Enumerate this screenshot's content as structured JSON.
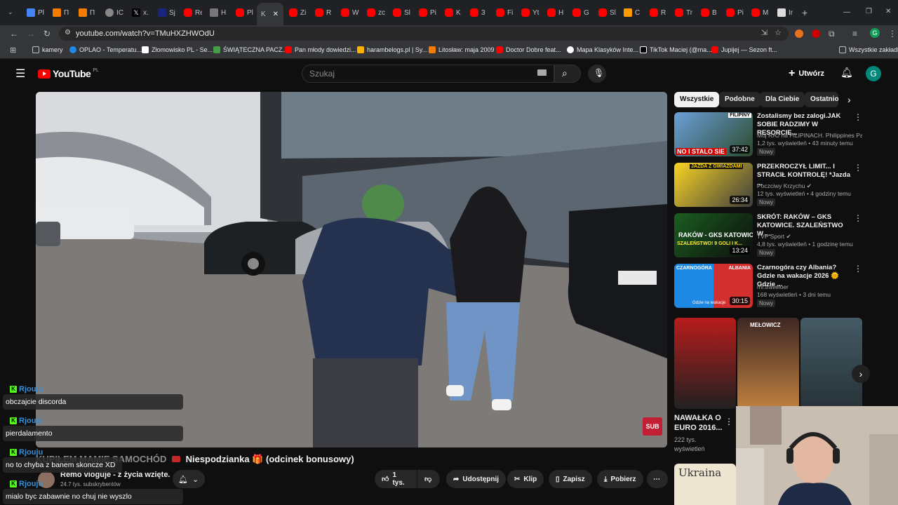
{
  "browser": {
    "tabs": [
      "Pl",
      "П",
      "П",
      "IC",
      "x.",
      "Sj",
      "Re",
      "H",
      "Pl",
      "K",
      "Zi",
      "R",
      "W",
      "zc",
      "Sl",
      "Pi",
      "K",
      "3",
      "Fi",
      "Yt",
      "H",
      "G",
      "Sl",
      "C",
      "R",
      "Tr",
      "B",
      "Pi",
      "M",
      "Ir"
    ],
    "url": "youtube.com/watch?v=TMuHXZHWOdU",
    "bookmarks": [
      "kamery",
      "OPLAO - Temperatu...",
      "Złomowisko PL - Se...",
      "ŚWIĄTECZNA PACZ...",
      "Pan młody dowiedzi...",
      "harambelogs.pl | Sy...",
      "Litosław: maja 2009",
      "Doctor Dobre feat...",
      "Mapa Klasyków Inte...",
      "TikTok Maciej (@ma...",
      "Jupijej — Sezon ft..."
    ],
    "all_bookmarks": "Wszystkie zakładki",
    "profile_initial": "G"
  },
  "youtube": {
    "logo": "YouTube",
    "region": "PL",
    "search_placeholder": "Szukaj",
    "create_label": "Utwórz",
    "avatar_initial": "G"
  },
  "video": {
    "title_prefix": "KUPIŁEM MAMIE SAMOCHÓD",
    "title_suffix": "Niespodzianka 🎁 (odcinek bonusowy)",
    "channel": "Remo vloguje - z życia wzięte.",
    "subscribers": "24.7 tys. subskrybentów",
    "sub_watermark": "SUB",
    "actions": {
      "likes": "1 tys.",
      "share": "Udostępnij",
      "clip": "Klip",
      "save": "Zapisz",
      "download": "Pobierz"
    }
  },
  "chips": [
    "Wszystkie",
    "Podobne",
    "Dla Ciebie",
    "Ostatnio"
  ],
  "recommendations": [
    {
      "title": "Zostalismy bez zalogi.JAK SOBIE RADZIMY W RESORCIE...",
      "channel": "Moj RAJ na FILIPINACH. Philippines Par...",
      "meta": "1,2 tys. wyświetleń • 43 minuty temu",
      "badge": "Nowy",
      "duration": "37:42",
      "thumb_text": "NO I STALO SIE",
      "thumb_top": "FILIPINY"
    },
    {
      "title": "PRZEKROCZYŁ LIMIT... I STRACIŁ KONTROLĘ! *Jazda ...",
      "channel": "Poczciwy Krzychu",
      "meta": "12 tys. wyświetleń • 4 godziny temu",
      "badge": "Nowy",
      "duration": "26:34",
      "thumb_text": "JAZDA Z GWIAZDAMI"
    },
    {
      "title": "SKRÓT: RAKÓW – GKS KATOWICE. SZALEŃSTWO W ...",
      "channel": "TVP Sport",
      "meta": "4,8 tys. wyświetleń • 1 godzinę temu",
      "badge": "Nowy",
      "duration": "13:24",
      "thumb_text": "RAKÓW - GKS KATOWICE",
      "thumb_sub": "SZALEŃSTWO! 9 GOLI I K..."
    },
    {
      "title": "Czarnogóra czy Albania? Gdzie na wakacje 2026 🌞 Gdzie ...",
      "channel": "mr.traveloer",
      "meta": "168 wyświetleń • 3 dni temu",
      "badge": "Nowy",
      "duration": "30:15",
      "thumb_left": "CZARNOGÓRA",
      "thumb_right": "ALBANIA",
      "thumb_sub": "Gdzie na wakacje"
    }
  ],
  "shorts": {
    "title": "NAWAŁKA O EURO 2016...",
    "views": "222 tys. wyświetleń",
    "thumb2_text": "MEŁOWICZ",
    "next_title": "Ukraina"
  },
  "chat": [
    {
      "user": "Rjouju",
      "message": "obczajcie discorda"
    },
    {
      "user": "Rjouju",
      "message": "pierdalamento"
    },
    {
      "user": "Rjouju",
      "message": "no to chyba z banem skoncze XD"
    },
    {
      "user": "Rjouju",
      "message": "mialo byc zabawnie no chuj nie wyszlo"
    }
  ],
  "colors": {
    "yt_red": "#ff0000",
    "accent_blue": "#3ea6ff",
    "kick_green": "#53fc18"
  }
}
